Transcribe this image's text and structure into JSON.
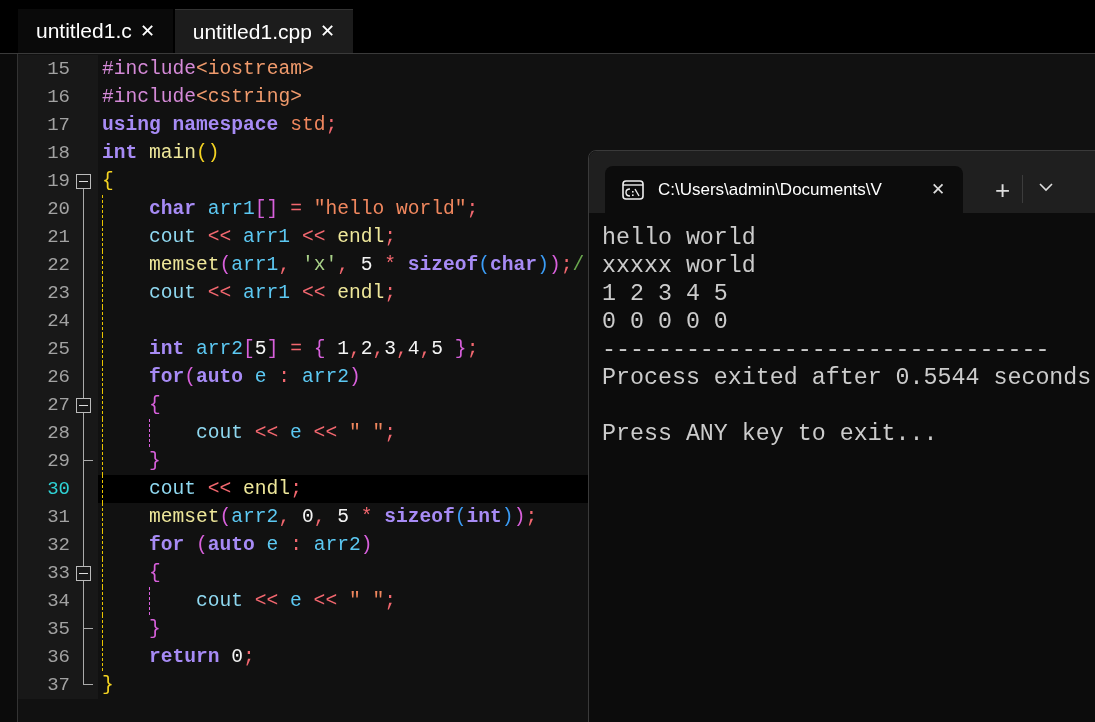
{
  "editor": {
    "tabs": [
      {
        "label": "untitled1.c",
        "close": "✕",
        "selected": false
      },
      {
        "label": "untitled1.cpp",
        "close": "✕",
        "selected": true
      }
    ],
    "lines": [
      {
        "number": "15",
        "kind": "plain",
        "tokens": [
          {
            "kind": "pre",
            "text": "#include"
          },
          {
            "kind": "hdr",
            "text": "<iostream>"
          }
        ]
      },
      {
        "number": "16",
        "kind": "plain",
        "tokens": [
          {
            "kind": "pre",
            "text": "#include"
          },
          {
            "kind": "hdr",
            "text": "<cstring>"
          }
        ]
      },
      {
        "number": "17",
        "kind": "plain",
        "tokens": [
          {
            "kind": "kw",
            "text": "using namespace "
          },
          {
            "kind": "str",
            "text": "std"
          },
          {
            "kind": "op",
            "text": ";"
          }
        ]
      },
      {
        "number": "18",
        "kind": "plain",
        "tokens": [
          {
            "kind": "kw",
            "text": "int "
          },
          {
            "kind": "fn",
            "text": "main"
          },
          {
            "kind": "br2",
            "text": "()"
          }
        ]
      },
      {
        "number": "19",
        "kind": "fold_start",
        "tokens": [
          {
            "kind": "br2",
            "text": "{"
          }
        ]
      },
      {
        "number": "20",
        "kind": "plain",
        "tokens": [
          {
            "kind": "kw",
            "text": "char "
          },
          {
            "kind": "id",
            "text": "arr1"
          },
          {
            "kind": "br",
            "text": "[]"
          },
          {
            "kind": "op",
            "text": " = "
          },
          {
            "kind": "str",
            "text": "\"hello world\""
          },
          {
            "kind": "op",
            "text": ";"
          }
        ]
      },
      {
        "number": "21",
        "kind": "plain",
        "tokens": [
          {
            "kind": "id2",
            "text": "cout"
          },
          {
            "kind": "op",
            "text": " << "
          },
          {
            "kind": "id",
            "text": "arr1"
          },
          {
            "kind": "op",
            "text": " << "
          },
          {
            "kind": "fn",
            "text": "endl"
          },
          {
            "kind": "op",
            "text": ";"
          }
        ]
      },
      {
        "number": "22",
        "kind": "plain",
        "tokens": [
          {
            "kind": "fn",
            "text": "memset"
          },
          {
            "kind": "br",
            "text": "("
          },
          {
            "kind": "id",
            "text": "arr1"
          },
          {
            "kind": "op",
            "text": ", "
          },
          {
            "kind": "chr",
            "text": "'x'"
          },
          {
            "kind": "op",
            "text": ", "
          },
          {
            "kind": "num",
            "text": "5"
          },
          {
            "kind": "op",
            "text": " * "
          },
          {
            "kind": "kw",
            "text": "sizeof"
          },
          {
            "kind": "br3",
            "text": "("
          },
          {
            "kind": "kw",
            "text": "char"
          },
          {
            "kind": "br3",
            "text": ")"
          },
          {
            "kind": "br",
            "text": ")"
          },
          {
            "kind": "op",
            "text": ";"
          },
          {
            "kind": "cmt",
            "text": "/"
          }
        ]
      },
      {
        "number": "23",
        "kind": "plain",
        "tokens": [
          {
            "kind": "id2",
            "text": "cout"
          },
          {
            "kind": "op",
            "text": " << "
          },
          {
            "kind": "id",
            "text": "arr1"
          },
          {
            "kind": "op",
            "text": " << "
          },
          {
            "kind": "fn",
            "text": "endl"
          },
          {
            "kind": "op",
            "text": ";"
          }
        ]
      },
      {
        "number": "24",
        "kind": "plain"
      },
      {
        "number": "25",
        "kind": "plain",
        "tokens": [
          {
            "kind": "kw",
            "text": "int "
          },
          {
            "kind": "id",
            "text": "arr2"
          },
          {
            "kind": "br",
            "text": "["
          },
          {
            "kind": "num",
            "text": "5"
          },
          {
            "kind": "br",
            "text": "]"
          },
          {
            "kind": "op",
            "text": " = "
          },
          {
            "kind": "br",
            "text": "{ "
          },
          {
            "kind": "num",
            "text": "1"
          },
          {
            "kind": "op",
            "text": ","
          },
          {
            "kind": "num",
            "text": "2"
          },
          {
            "kind": "op",
            "text": ","
          },
          {
            "kind": "num",
            "text": "3"
          },
          {
            "kind": "op",
            "text": ","
          },
          {
            "kind": "num",
            "text": "4"
          },
          {
            "kind": "op",
            "text": ","
          },
          {
            "kind": "num",
            "text": "5 "
          },
          {
            "kind": "br",
            "text": "}"
          },
          {
            "kind": "op",
            "text": ";"
          }
        ]
      },
      {
        "number": "26",
        "kind": "plain",
        "tokens": [
          {
            "kind": "kw",
            "text": "for"
          },
          {
            "kind": "br",
            "text": "("
          },
          {
            "kind": "kw",
            "text": "auto "
          },
          {
            "kind": "id",
            "text": "e"
          },
          {
            "kind": "op",
            "text": " : "
          },
          {
            "kind": "id",
            "text": "arr2"
          },
          {
            "kind": "br",
            "text": ")"
          }
        ]
      },
      {
        "number": "27",
        "kind": "fold_start",
        "tokens": [
          {
            "kind": "br",
            "text": "{"
          }
        ]
      },
      {
        "number": "28",
        "kind": "plain",
        "tokens": [
          {
            "kind": "id2",
            "text": "cout"
          },
          {
            "kind": "op",
            "text": " << "
          },
          {
            "kind": "id",
            "text": "e"
          },
          {
            "kind": "op",
            "text": " << "
          },
          {
            "kind": "str",
            "text": "\" \""
          },
          {
            "kind": "op",
            "text": ";"
          }
        ]
      },
      {
        "number": "29",
        "kind": "fold_end",
        "tokens": [
          {
            "kind": "br",
            "text": "}"
          }
        ]
      },
      {
        "number": "30",
        "kind": "plain",
        "current": true,
        "tokens": [
          {
            "kind": "id2",
            "text": "cout"
          },
          {
            "kind": "op",
            "text": " << "
          },
          {
            "kind": "fn",
            "text": "endl"
          },
          {
            "kind": "op",
            "text": ";"
          }
        ]
      },
      {
        "number": "31",
        "kind": "plain",
        "tokens": [
          {
            "kind": "fn",
            "text": "memset"
          },
          {
            "kind": "br",
            "text": "("
          },
          {
            "kind": "id",
            "text": "arr2"
          },
          {
            "kind": "op",
            "text": ", "
          },
          {
            "kind": "num",
            "text": "0"
          },
          {
            "kind": "op",
            "text": ", "
          },
          {
            "kind": "num",
            "text": "5"
          },
          {
            "kind": "op",
            "text": " * "
          },
          {
            "kind": "kw",
            "text": "sizeof"
          },
          {
            "kind": "br3",
            "text": "("
          },
          {
            "kind": "kw",
            "text": "int"
          },
          {
            "kind": "br3",
            "text": ")"
          },
          {
            "kind": "br",
            "text": ")"
          },
          {
            "kind": "op",
            "text": ";"
          }
        ]
      },
      {
        "number": "32",
        "kind": "plain",
        "tokens": [
          {
            "kind": "kw",
            "text": "for "
          },
          {
            "kind": "br",
            "text": "("
          },
          {
            "kind": "kw",
            "text": "auto "
          },
          {
            "kind": "id",
            "text": "e"
          },
          {
            "kind": "op",
            "text": " : "
          },
          {
            "kind": "id",
            "text": "arr2"
          },
          {
            "kind": "br",
            "text": ")"
          }
        ]
      },
      {
        "number": "33",
        "kind": "fold_start",
        "tokens": [
          {
            "kind": "br",
            "text": "{"
          }
        ]
      },
      {
        "number": "34",
        "kind": "plain",
        "tokens": [
          {
            "kind": "id2",
            "text": "cout"
          },
          {
            "kind": "op",
            "text": " << "
          },
          {
            "kind": "id",
            "text": "e"
          },
          {
            "kind": "op",
            "text": " << "
          },
          {
            "kind": "str",
            "text": "\" \""
          },
          {
            "kind": "op",
            "text": ";"
          }
        ]
      },
      {
        "number": "35",
        "kind": "fold_end",
        "tokens": [
          {
            "kind": "br",
            "text": "}"
          }
        ]
      },
      {
        "number": "36",
        "kind": "plain",
        "tokens": [
          {
            "kind": "kw",
            "text": "return "
          },
          {
            "kind": "num",
            "text": "0"
          },
          {
            "kind": "op",
            "text": ";"
          }
        ]
      },
      {
        "number": "37",
        "kind": "fold_end",
        "tokens": [
          {
            "kind": "br2",
            "text": "}"
          }
        ]
      }
    ]
  },
  "terminal": {
    "tab_title": "C:\\Users\\admin\\Documents\\V",
    "tab_close": "✕",
    "new_tab": "+",
    "output": [
      {
        "text": "hello world"
      },
      {
        "text": "xxxxx world"
      },
      {
        "text": "1 2 3 4 5"
      },
      {
        "text": "0 0 0 0 0"
      },
      {
        "text": "--------------------------------"
      },
      {
        "text": "Process exited after 0.5544 seconds"
      },
      {
        "text": "Press ANY key to exit...",
        "gap_before": true
      }
    ]
  }
}
